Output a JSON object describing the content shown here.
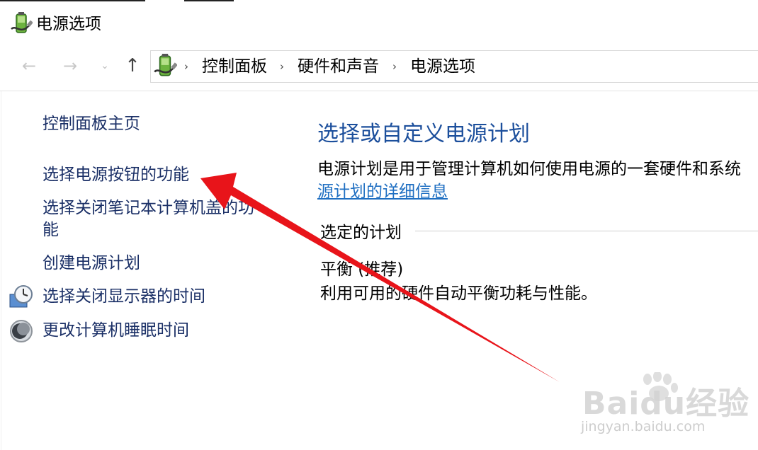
{
  "window": {
    "title": "电源选项"
  },
  "nav": {
    "back_glyph": "←",
    "forward_glyph": "→",
    "recent_glyph": "⌄",
    "up_glyph": "↑",
    "separator_glyph": "›"
  },
  "breadcrumb": {
    "items": [
      "控制面板",
      "硬件和声音",
      "电源选项"
    ]
  },
  "sidebar": {
    "items": [
      {
        "label": "控制面板主页",
        "icon": ""
      },
      {
        "label": "选择电源按钮的功能",
        "icon": ""
      },
      {
        "label": "选择关闭笔记本计算机盖的功",
        "label_line2": "能",
        "icon": ""
      },
      {
        "label": "创建电源计划",
        "icon": ""
      },
      {
        "label": "选择关闭显示器的时间",
        "icon": "clock-monitor-icon"
      },
      {
        "label": "更改计算机睡眠时间",
        "icon": "moon-icon"
      }
    ]
  },
  "main": {
    "title": "选择或自定义电源计划",
    "description": "电源计划是用于管理计算机如何使用电源的一套硬件和系统",
    "description_link": "源计划的详细信息",
    "selected_plan_heading": "选定的计划",
    "plan_name": "平衡 (推荐)",
    "plan_description": "利用可用的硬件自动平衡功耗与性能。"
  },
  "watermark": {
    "text": "Baidu经验",
    "sub": "jingyan.baidu.com"
  },
  "colors": {
    "link": "#1a2f66",
    "heading": "#1c4f9c",
    "hyperlink": "#1f6fc2",
    "arrow": "#e8141a"
  }
}
